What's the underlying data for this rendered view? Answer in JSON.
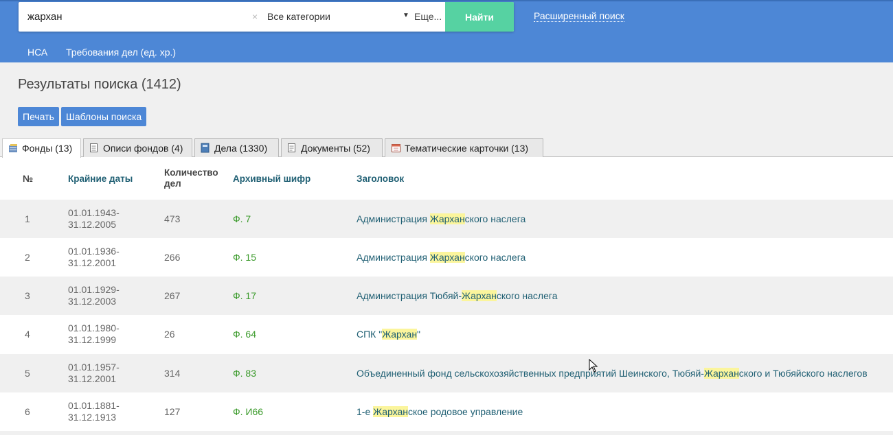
{
  "search": {
    "query": "жархан",
    "clear_symbol": "×",
    "category": "Все категории",
    "more": "Еще...",
    "find_label": "Найти",
    "advanced": "Расширенный поиск"
  },
  "nav": {
    "items": [
      {
        "label": "НСА"
      },
      {
        "label": "Требования дел (ед. хр.)"
      }
    ]
  },
  "results": {
    "title": "Результаты поиска (1412)",
    "print_label": "Печать",
    "templates_label": "Шаблоны поиска"
  },
  "tabs": [
    {
      "label": "Фонды (13)",
      "icon": "fonds-icon"
    },
    {
      "label": "Описи фондов (4)",
      "icon": "inventory-icon"
    },
    {
      "label": "Дела (1330)",
      "icon": "cases-icon"
    },
    {
      "label": "Документы (52)",
      "icon": "documents-icon"
    },
    {
      "label": "Тематические карточки (13)",
      "icon": "calendar-cards-icon"
    }
  ],
  "table": {
    "headers": {
      "num": "№",
      "dates": "Крайние даты",
      "count_line1": "Количество",
      "count_line2": "дел",
      "code": "Архивный шифр",
      "title": "Заголовок"
    },
    "rows": [
      {
        "num": "1",
        "date_from": "01.01.1943-",
        "date_to": "31.12.2005",
        "count": "473",
        "code": "Ф. 7",
        "title_pre": "Администрация ",
        "title_hl": "Жархан",
        "title_post": "ского наслега"
      },
      {
        "num": "2",
        "date_from": "01.01.1936-",
        "date_to": "31.12.2001",
        "count": "266",
        "code": "Ф. 15",
        "title_pre": "Администрация ",
        "title_hl": "Жархан",
        "title_post": "ского наслега"
      },
      {
        "num": "3",
        "date_from": "01.01.1929-",
        "date_to": "31.12.2003",
        "count": "267",
        "code": "Ф. 17",
        "title_pre": "Администрация Тюбяй-",
        "title_hl": "Жархан",
        "title_post": "ского наслега"
      },
      {
        "num": "4",
        "date_from": "01.01.1980-",
        "date_to": "31.12.1999",
        "count": "26",
        "code": "Ф. 64",
        "title_pre": "СПК \"",
        "title_hl": "Жархан",
        "title_post": "\""
      },
      {
        "num": "5",
        "date_from": "01.01.1957-",
        "date_to": "31.12.2001",
        "count": "314",
        "code": "Ф. 83",
        "title_pre": "Объединенный фонд сельскохозяйственных предприятий Шеинского, Тюбяй-",
        "title_hl": "Жархан",
        "title_post": "ского и Тюбяйского наслегов"
      },
      {
        "num": "6",
        "date_from": "01.01.1881-",
        "date_to": "31.12.1913",
        "count": "127",
        "code": "Ф. И66",
        "title_pre": "1-е ",
        "title_hl": "Жархан",
        "title_post": "ское родовое управление"
      }
    ]
  }
}
